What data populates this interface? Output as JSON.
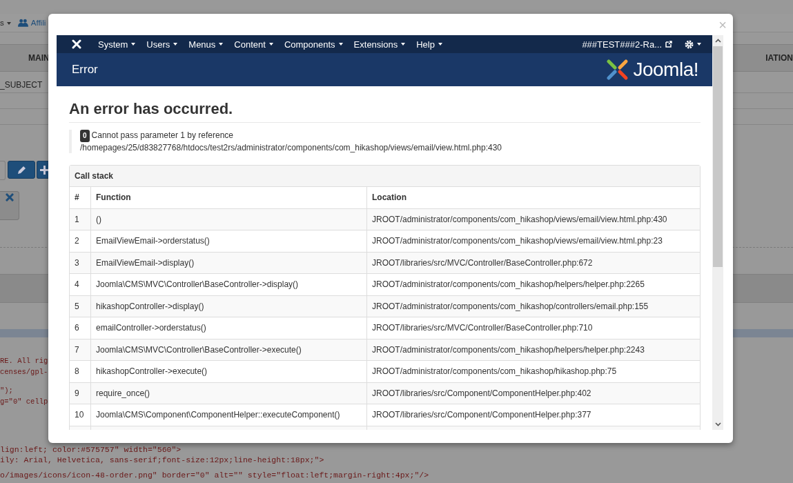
{
  "background": {
    "toolbar": [
      "s",
      "Affili"
    ],
    "columns": [
      "MAIN",
      "IATION"
    ],
    "field": "_SUBJECT",
    "code_lines": [
      "RE. All rig",
      "censes/gpl-",
      "\");",
      "g=\"0\" cellp"
    ],
    "code_lines_below": [
      "lign:left; color:#575757\" width=\"560\">",
      "ily: Arial, Helvetica, sans-serif;font-size:12px;line-height:18px;\">",
      "o/images/icons/icon-48-order.png\" border=\"0\" alt=\"\" style=\"float:left;margin-right:4px;\"/>"
    ]
  },
  "modal": {
    "close": "×",
    "navbar": {
      "menus": [
        "System",
        "Users",
        "Menus",
        "Content",
        "Components",
        "Extensions",
        "Help"
      ],
      "site_link": "###TEST###2-Ra..."
    },
    "header": {
      "title": "Error",
      "logo_text": "Joomla!"
    },
    "heading": "An error has occurred.",
    "error": {
      "code": "0",
      "message": "Cannot pass parameter 1 by reference",
      "path": "/homepages/25/d83827768/htdocs/test2rs/administrator/components/com_hikashop/views/email/view.html.php:430"
    },
    "call_stack": {
      "title": "Call stack",
      "columns": [
        "#",
        "Function",
        "Location"
      ],
      "rows": [
        [
          "1",
          "()",
          "JROOT/administrator/components/com_hikashop/views/email/view.html.php:430"
        ],
        [
          "2",
          "EmailViewEmail->orderstatus()",
          "JROOT/administrator/components/com_hikashop/views/email/view.html.php:23"
        ],
        [
          "3",
          "EmailViewEmail->display()",
          "JROOT/libraries/src/MVC/Controller/BaseController.php:672"
        ],
        [
          "4",
          "Joomla\\CMS\\MVC\\Controller\\BaseController->display()",
          "JROOT/administrator/components/com_hikashop/helpers/helper.php:2265"
        ],
        [
          "5",
          "hikashopController->display()",
          "JROOT/administrator/components/com_hikashop/controllers/email.php:155"
        ],
        [
          "6",
          "emailController->orderstatus()",
          "JROOT/libraries/src/MVC/Controller/BaseController.php:710"
        ],
        [
          "7",
          "Joomla\\CMS\\MVC\\Controller\\BaseController->execute()",
          "JROOT/administrator/components/com_hikashop/helpers/helper.php:2243"
        ],
        [
          "8",
          "hikashopController->execute()",
          "JROOT/administrator/components/com_hikashop/hikashop.php:75"
        ],
        [
          "9",
          "require_once()",
          "JROOT/libraries/src/Component/ComponentHelper.php:402"
        ],
        [
          "10",
          "Joomla\\CMS\\Component\\ComponentHelper::executeComponent()",
          "JROOT/libraries/src/Component/ComponentHelper.php:377"
        ]
      ]
    }
  }
}
